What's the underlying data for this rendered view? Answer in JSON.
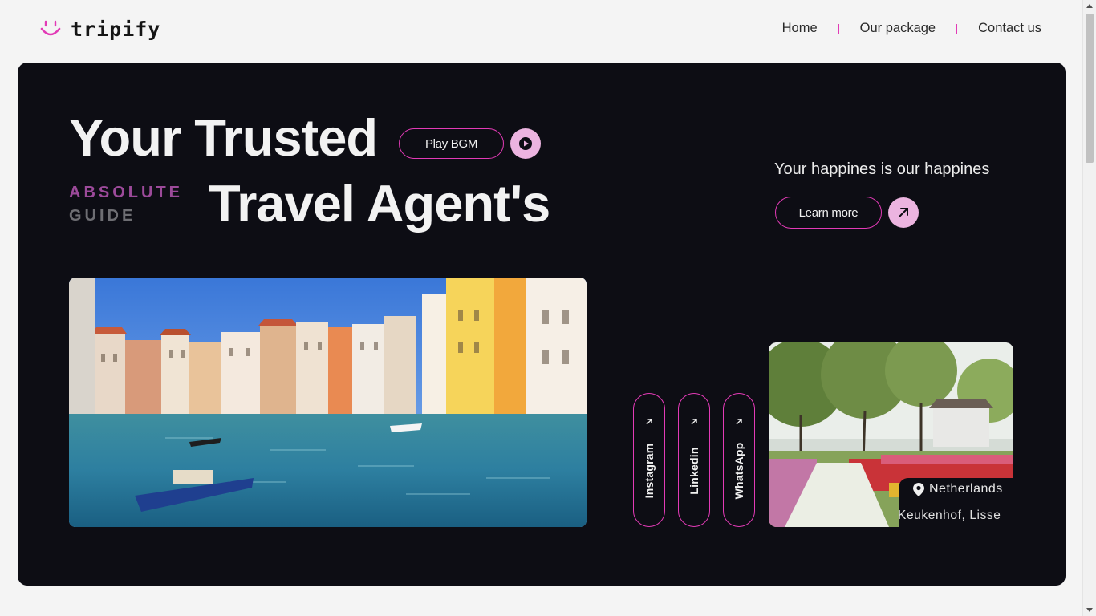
{
  "brand": {
    "name": "tripify",
    "accent": "#e23ab6",
    "soft_accent": "#ecb4e0"
  },
  "nav": {
    "items": [
      "Home",
      "Our package",
      "Contact us"
    ]
  },
  "hero": {
    "title_line1": "Your Trusted",
    "title_line2": "Travel Agent's",
    "badge_line1": "ABSOLUTE",
    "badge_line2": "GUIDE",
    "play_label": "Play BGM",
    "tagline": "Your happines is our happines",
    "learn_label": "Learn more"
  },
  "social": {
    "items": [
      "Instagram",
      "Linkedin",
      "WhatsApp"
    ]
  },
  "location": {
    "country": "Netherlands",
    "place": "Keukenhof, Lisse"
  }
}
